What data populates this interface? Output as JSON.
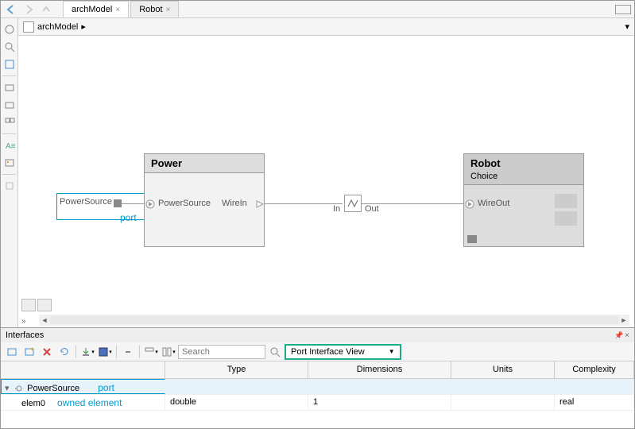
{
  "tabs": [
    {
      "label": "archModel",
      "active": true
    },
    {
      "label": "Robot",
      "active": false
    }
  ],
  "breadcrumb": {
    "model": "archModel"
  },
  "canvas": {
    "external_port": "PowerSource",
    "port_annotation": "port",
    "power_block": {
      "title": "Power",
      "in_port": "PowerSource",
      "out_port": "WireIn"
    },
    "variant": {
      "in": "In",
      "out": "Out"
    },
    "robot_block": {
      "title": "Robot",
      "subtitle": "Choice",
      "in_port": "WireOut"
    }
  },
  "interfaces": {
    "title": "Interfaces",
    "search_placeholder": "Search",
    "view_mode": "Port Interface View",
    "columns": {
      "name": "",
      "type": "Type",
      "dim": "Dimensions",
      "units": "Units",
      "complex": "Complexity"
    },
    "rows": [
      {
        "name": "PowerSource",
        "annotation": "port",
        "type": "",
        "dim": "",
        "units": "",
        "complex": "",
        "level": 0,
        "expanded": true
      },
      {
        "name": "elem0",
        "annotation": "owned element",
        "type": "double",
        "dim": "1",
        "units": "",
        "complex": "real",
        "level": 1
      }
    ]
  }
}
